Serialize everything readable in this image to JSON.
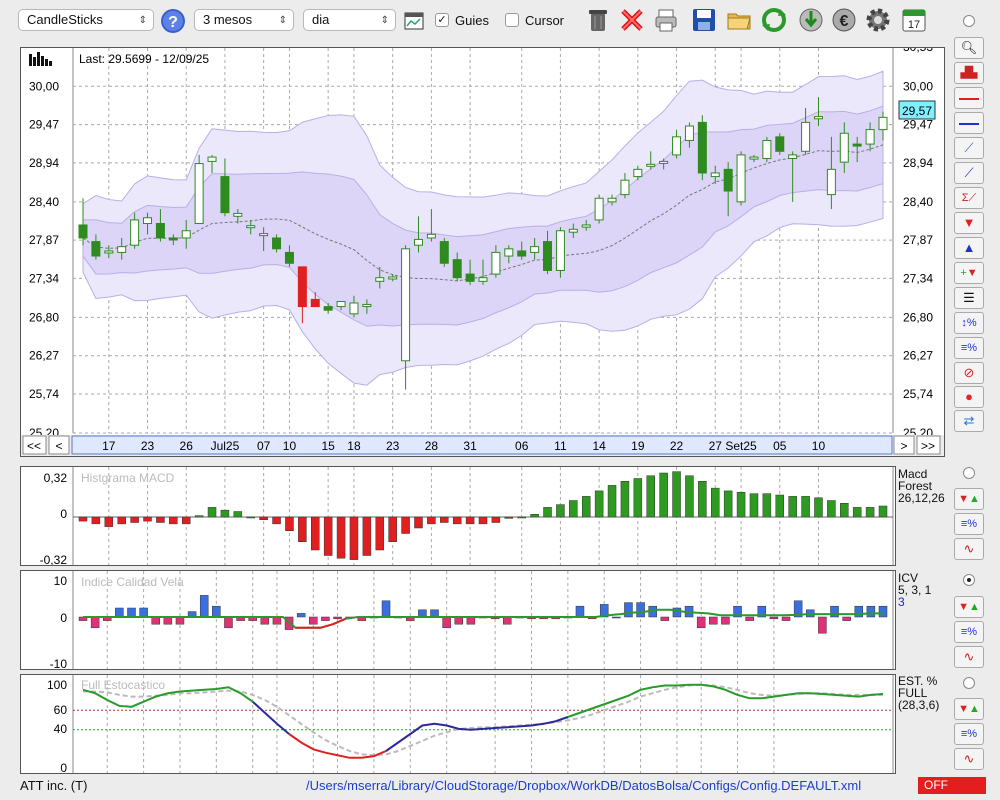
{
  "toolbar": {
    "chart_type": "CandleSticks",
    "period": "3 mesos",
    "interval": "dia",
    "guides_label": "Guies",
    "guides_checked": true,
    "cursor_label": "Cursor",
    "cursor_checked": false
  },
  "main_chart": {
    "last_label": "Last: 29.5699 - 12/09/25",
    "price_ticks": [
      "30,00",
      "29,47",
      "28,94",
      "28,40",
      "27,87",
      "27,34",
      "26,80",
      "26,27",
      "25,74",
      "25,20"
    ],
    "top_tick_partial": "30,53",
    "current_price": "29,57",
    "date_ticks": [
      "17",
      "23",
      "26",
      "Jul25",
      "07",
      "10",
      "15",
      "18",
      "23",
      "28",
      "31",
      "06",
      "11",
      "14",
      "19",
      "22",
      "27",
      "Set25",
      "05",
      "10"
    ],
    "nav_left": [
      "<<",
      "<"
    ],
    "nav_right": [
      ">",
      ">>"
    ]
  },
  "macd": {
    "title": "Histgrama MACD",
    "ticks": [
      "0,32",
      "0",
      "-0,32"
    ],
    "side_label_1": "Macd",
    "side_label_2": "Forest",
    "params": "26,12,26"
  },
  "icv": {
    "title": "Indice Calidad Vela",
    "ticks": [
      "10",
      "0",
      "-10"
    ],
    "side_label": "ICV",
    "params": "5, 3, 1",
    "extra": "3"
  },
  "stoch": {
    "title": "Full Estocastico",
    "ticks": [
      "100",
      "60",
      "40",
      "0"
    ],
    "side_label_1": "EST. %",
    "side_label_2": "FULL",
    "params": "(28,3,6)"
  },
  "status": {
    "ticker": "ATT inc. (T)",
    "path": "/Users/mserra/Library/CloudStorage/Dropbox/WorkDB/DatosBolsa/Configs/Config.DEFAULT.xml",
    "mode": "OFF"
  },
  "colors": {
    "up": "#2e8b1e",
    "down": "#e02020",
    "band": "#e6e0f8",
    "accent": "#7ff0ff"
  },
  "chart_data": {
    "type": "candlestick",
    "candles": [
      {
        "o": 28.08,
        "h": 28.45,
        "l": 27.8,
        "c": 27.9
      },
      {
        "o": 27.85,
        "h": 27.95,
        "l": 27.6,
        "c": 27.65
      },
      {
        "o": 27.7,
        "h": 27.8,
        "l": 27.62,
        "c": 27.72
      },
      {
        "o": 27.7,
        "h": 27.9,
        "l": 27.6,
        "c": 27.78
      },
      {
        "o": 27.8,
        "h": 28.25,
        "l": 27.75,
        "c": 28.15
      },
      {
        "o": 28.1,
        "h": 28.25,
        "l": 27.95,
        "c": 28.18
      },
      {
        "o": 28.1,
        "h": 28.3,
        "l": 27.85,
        "c": 27.9
      },
      {
        "o": 27.9,
        "h": 27.95,
        "l": 27.8,
        "c": 27.88
      },
      {
        "o": 27.9,
        "h": 28.15,
        "l": 27.75,
        "c": 28.0
      },
      {
        "o": 28.1,
        "h": 29.05,
        "l": 28.1,
        "c": 28.93
      },
      {
        "o": 28.96,
        "h": 29.05,
        "l": 28.8,
        "c": 29.02
      },
      {
        "o": 28.75,
        "h": 29.0,
        "l": 28.2,
        "c": 28.25
      },
      {
        "o": 28.2,
        "h": 28.3,
        "l": 28.1,
        "c": 28.24
      },
      {
        "o": 28.05,
        "h": 28.15,
        "l": 27.95,
        "c": 28.07
      },
      {
        "o": 27.95,
        "h": 28.05,
        "l": 27.72,
        "c": 27.96
      },
      {
        "o": 27.9,
        "h": 27.95,
        "l": 27.7,
        "c": 27.75
      },
      {
        "o": 27.7,
        "h": 27.8,
        "l": 27.5,
        "c": 27.55
      },
      {
        "o": 27.5,
        "h": 27.5,
        "l": 26.72,
        "c": 26.95
      },
      {
        "o": 27.05,
        "h": 27.15,
        "l": 26.95,
        "c": 26.95
      },
      {
        "o": 26.95,
        "h": 27.0,
        "l": 26.85,
        "c": 26.9
      },
      {
        "o": 26.95,
        "h": 27.02,
        "l": 26.9,
        "c": 27.02
      },
      {
        "o": 26.85,
        "h": 27.1,
        "l": 26.8,
        "c": 27.0
      },
      {
        "o": 26.95,
        "h": 27.05,
        "l": 26.85,
        "c": 26.98
      },
      {
        "o": 27.3,
        "h": 27.5,
        "l": 27.2,
        "c": 27.35
      },
      {
        "o": 27.35,
        "h": 27.4,
        "l": 27.3,
        "c": 27.36
      },
      {
        "o": 26.2,
        "h": 27.8,
        "l": 25.8,
        "c": 27.75
      },
      {
        "o": 27.8,
        "h": 28.2,
        "l": 27.7,
        "c": 27.88
      },
      {
        "o": 27.9,
        "h": 28.3,
        "l": 27.85,
        "c": 27.95
      },
      {
        "o": 27.85,
        "h": 27.9,
        "l": 27.5,
        "c": 27.55
      },
      {
        "o": 27.6,
        "h": 27.7,
        "l": 27.3,
        "c": 27.35
      },
      {
        "o": 27.4,
        "h": 27.6,
        "l": 27.25,
        "c": 27.3
      },
      {
        "o": 27.3,
        "h": 27.6,
        "l": 27.25,
        "c": 27.35
      },
      {
        "o": 27.4,
        "h": 27.8,
        "l": 27.35,
        "c": 27.7
      },
      {
        "o": 27.65,
        "h": 27.8,
        "l": 27.55,
        "c": 27.75
      },
      {
        "o": 27.72,
        "h": 27.85,
        "l": 27.6,
        "c": 27.65
      },
      {
        "o": 27.7,
        "h": 27.9,
        "l": 27.6,
        "c": 27.78
      },
      {
        "o": 27.85,
        "h": 28.0,
        "l": 27.4,
        "c": 27.45
      },
      {
        "o": 27.45,
        "h": 28.05,
        "l": 27.35,
        "c": 28.0
      },
      {
        "o": 27.98,
        "h": 28.1,
        "l": 27.9,
        "c": 28.02
      },
      {
        "o": 28.05,
        "h": 28.15,
        "l": 28.0,
        "c": 28.08
      },
      {
        "o": 28.15,
        "h": 28.5,
        "l": 28.1,
        "c": 28.45
      },
      {
        "o": 28.4,
        "h": 28.5,
        "l": 28.35,
        "c": 28.45
      },
      {
        "o": 28.5,
        "h": 28.8,
        "l": 28.45,
        "c": 28.7
      },
      {
        "o": 28.75,
        "h": 28.9,
        "l": 28.7,
        "c": 28.85
      },
      {
        "o": 28.9,
        "h": 29.1,
        "l": 28.85,
        "c": 28.92
      },
      {
        "o": 28.95,
        "h": 29.0,
        "l": 28.85,
        "c": 28.96
      },
      {
        "o": 29.05,
        "h": 29.4,
        "l": 29.0,
        "c": 29.3
      },
      {
        "o": 29.25,
        "h": 29.5,
        "l": 29.15,
        "c": 29.45
      },
      {
        "o": 29.5,
        "h": 29.6,
        "l": 28.7,
        "c": 28.8
      },
      {
        "o": 28.75,
        "h": 28.9,
        "l": 28.65,
        "c": 28.8
      },
      {
        "o": 28.85,
        "h": 28.95,
        "l": 28.2,
        "c": 28.55
      },
      {
        "o": 28.4,
        "h": 29.1,
        "l": 28.35,
        "c": 29.05
      },
      {
        "o": 29.0,
        "h": 29.05,
        "l": 28.95,
        "c": 29.02
      },
      {
        "o": 29.0,
        "h": 29.3,
        "l": 28.95,
        "c": 29.25
      },
      {
        "o": 29.3,
        "h": 29.35,
        "l": 29.05,
        "c": 29.1
      },
      {
        "o": 29.0,
        "h": 29.1,
        "l": 28.4,
        "c": 29.05
      },
      {
        "o": 29.1,
        "h": 29.7,
        "l": 29.05,
        "c": 29.5
      },
      {
        "o": 29.55,
        "h": 29.85,
        "l": 29.45,
        "c": 29.58
      },
      {
        "o": 28.5,
        "h": 29.3,
        "l": 28.3,
        "c": 28.85
      },
      {
        "o": 28.95,
        "h": 29.5,
        "l": 28.8,
        "c": 29.35
      },
      {
        "o": 29.2,
        "h": 29.3,
        "l": 28.95,
        "c": 29.18
      },
      {
        "o": 29.2,
        "h": 29.5,
        "l": 29.1,
        "c": 29.4
      },
      {
        "o": 29.4,
        "h": 29.65,
        "l": 29.25,
        "c": 29.57
      }
    ],
    "macd_hist": [
      -0.03,
      -0.05,
      -0.07,
      -0.05,
      -0.04,
      -0.03,
      -0.04,
      -0.05,
      -0.05,
      0.01,
      0.07,
      0.05,
      0.04,
      0,
      -0.02,
      -0.05,
      -0.1,
      -0.18,
      -0.24,
      -0.28,
      -0.3,
      -0.31,
      -0.28,
      -0.24,
      -0.18,
      -0.12,
      -0.08,
      -0.05,
      -0.04,
      -0.05,
      -0.05,
      -0.05,
      -0.04,
      -0.01,
      0,
      0.02,
      0.07,
      0.09,
      0.12,
      0.15,
      0.19,
      0.23,
      0.26,
      0.28,
      0.3,
      0.32,
      0.33,
      0.3,
      0.26,
      0.21,
      0.19,
      0.18,
      0.17,
      0.17,
      0.16,
      0.15,
      0.15,
      0.14,
      0.12,
      0.1,
      0.07,
      0.07,
      0.08
    ],
    "icv": [
      -1,
      -3,
      -1,
      2.5,
      2.5,
      2.5,
      -2,
      -2,
      -2,
      1.5,
      6,
      3,
      -3,
      -1,
      -1,
      -2,
      -2,
      -3.5,
      1,
      -2,
      -1,
      -0.5,
      0,
      -1,
      0,
      4.5,
      0,
      -1,
      2,
      2,
      -3,
      -2,
      -2,
      0,
      -0.5,
      -2,
      0,
      -0.5,
      -0.5,
      -0.5,
      0,
      3,
      -0.5,
      3.5,
      0,
      4,
      4,
      3,
      -1,
      2.5,
      3,
      -3,
      -2,
      -2,
      3,
      -1,
      3,
      -0.5,
      -1,
      4.5,
      2,
      -4.5,
      3,
      -1,
      3,
      3,
      3
    ],
    "icv_signal": [
      0,
      0,
      0,
      0,
      0,
      0,
      0,
      0,
      0,
      0,
      0,
      0,
      0,
      0,
      0,
      0,
      0,
      -3,
      -3,
      -3,
      -2,
      -0.5,
      0,
      0,
      0,
      0,
      0,
      0,
      0,
      0,
      0,
      0,
      0,
      0,
      0,
      0,
      0,
      0,
      0,
      0,
      0,
      0,
      0.5,
      0.8,
      1.2,
      1.5,
      2,
      2,
      1.5,
      1.2,
      1,
      0.5,
      0.5,
      0.5,
      0.5,
      0.5,
      0.5,
      0.6,
      0.8,
      0.8,
      0.8,
      0.8,
      0.8,
      1,
      1
    ],
    "stoch_k": [
      92,
      88,
      80,
      73,
      72,
      78,
      84,
      88,
      90,
      91,
      92,
      93,
      95,
      88,
      78,
      65,
      52,
      40,
      30,
      22,
      18,
      15,
      12,
      12,
      14,
      20,
      30,
      40,
      50,
      52,
      50,
      46,
      45,
      46,
      47,
      48,
      49,
      50,
      52,
      55,
      60,
      65,
      70,
      75,
      80,
      85,
      92,
      95,
      97,
      97,
      98,
      98,
      96,
      92,
      86,
      82,
      82,
      84,
      86,
      88,
      88,
      87,
      86,
      85,
      84,
      86,
      87
    ],
    "stoch_d": [
      90,
      90,
      89,
      86,
      84,
      84,
      85,
      86,
      88,
      88,
      89,
      90,
      91,
      90,
      86,
      80,
      72,
      62,
      52,
      42,
      33,
      26,
      20,
      16,
      15,
      16,
      20,
      26,
      32,
      38,
      42,
      46,
      47,
      48,
      48,
      49,
      50,
      51,
      52,
      54,
      56,
      59,
      63,
      68,
      73,
      78,
      84,
      88,
      92,
      95,
      97,
      98,
      97,
      95,
      92,
      88,
      86,
      85,
      86,
      87,
      88,
      88,
      87,
      86,
      86,
      86,
      86
    ],
    "date_ticks": [
      "17",
      "23",
      "26",
      "Jul25",
      "07",
      "10",
      "15",
      "18",
      "23",
      "28",
      "31",
      "06",
      "11",
      "14",
      "19",
      "22",
      "27",
      "Set25",
      "05",
      "10"
    ],
    "ylim": [
      25.2,
      30.53
    ],
    "last_price": 29.5699,
    "last_date": "12/09/25"
  }
}
